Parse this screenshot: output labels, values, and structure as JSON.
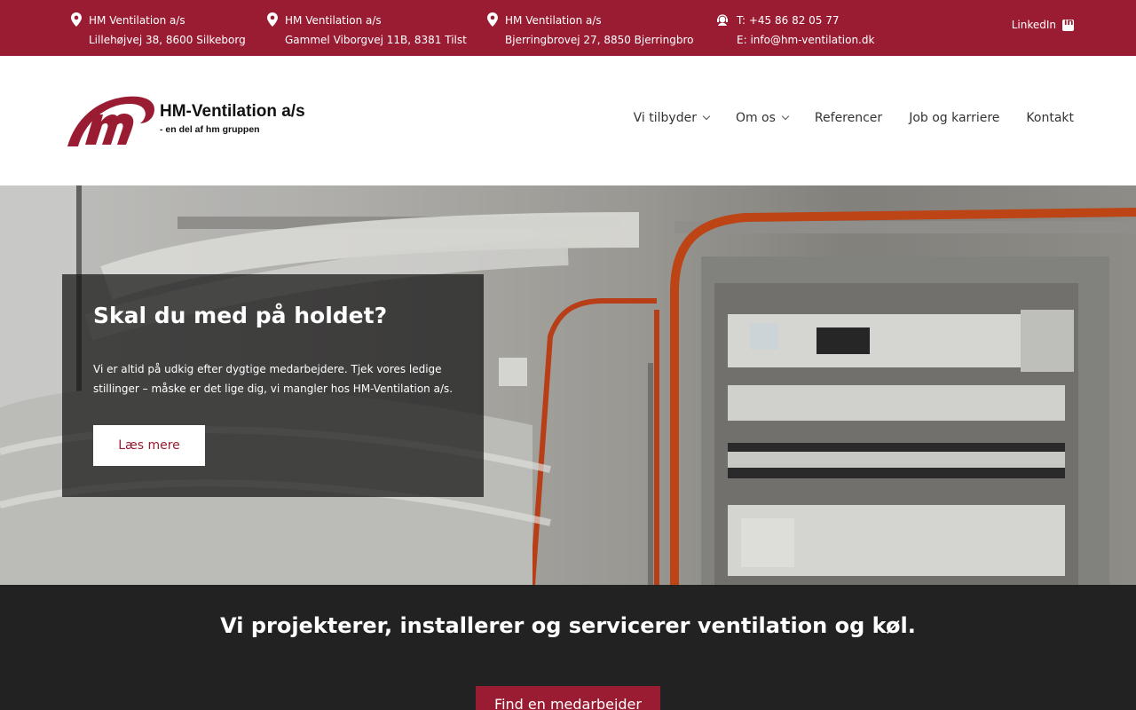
{
  "topbar": {
    "locations": [
      {
        "name": "HM Ventilation a/s",
        "address": "Lillehøjvej 38, 8600 Silkeborg"
      },
      {
        "name": "HM Ventilation a/s",
        "address": "Gammel Viborgvej 11B, 8381 Tilst"
      },
      {
        "name": "HM Ventilation a/s",
        "address": "Bjerringbrovej 27, 8850 Bjerringbro"
      }
    ],
    "contact": {
      "phone": "T: +45 86 82 05 77",
      "email": "E: info@hm-ventilation.dk"
    },
    "linkedin_label": "LinkedIn"
  },
  "header": {
    "logo_name": "HM-Ventilation a/s",
    "logo_tagline": "- en del af hm gruppen",
    "nav": [
      {
        "label": "Vi tilbyder",
        "has_dropdown": true
      },
      {
        "label": "Om os",
        "has_dropdown": true
      },
      {
        "label": "Referencer",
        "has_dropdown": false
      },
      {
        "label": "Job og karriere",
        "has_dropdown": false
      },
      {
        "label": "Kontakt",
        "has_dropdown": false
      }
    ]
  },
  "hero": {
    "title": "Skal du med på holdet?",
    "text": "Vi er altid på udkig efter dygtige medarbejdere. Tjek vores ledige stillinger – måske er det lige dig, vi mangler hos HM-Ventilation a/s.",
    "button_label": "Læs mere"
  },
  "section": {
    "title": "Vi projekterer, installerer og servicerer ventilation og køl.",
    "button_label": "Find en medarbejder"
  },
  "colors": {
    "brand": "#9a1c33",
    "dark": "#222222"
  }
}
